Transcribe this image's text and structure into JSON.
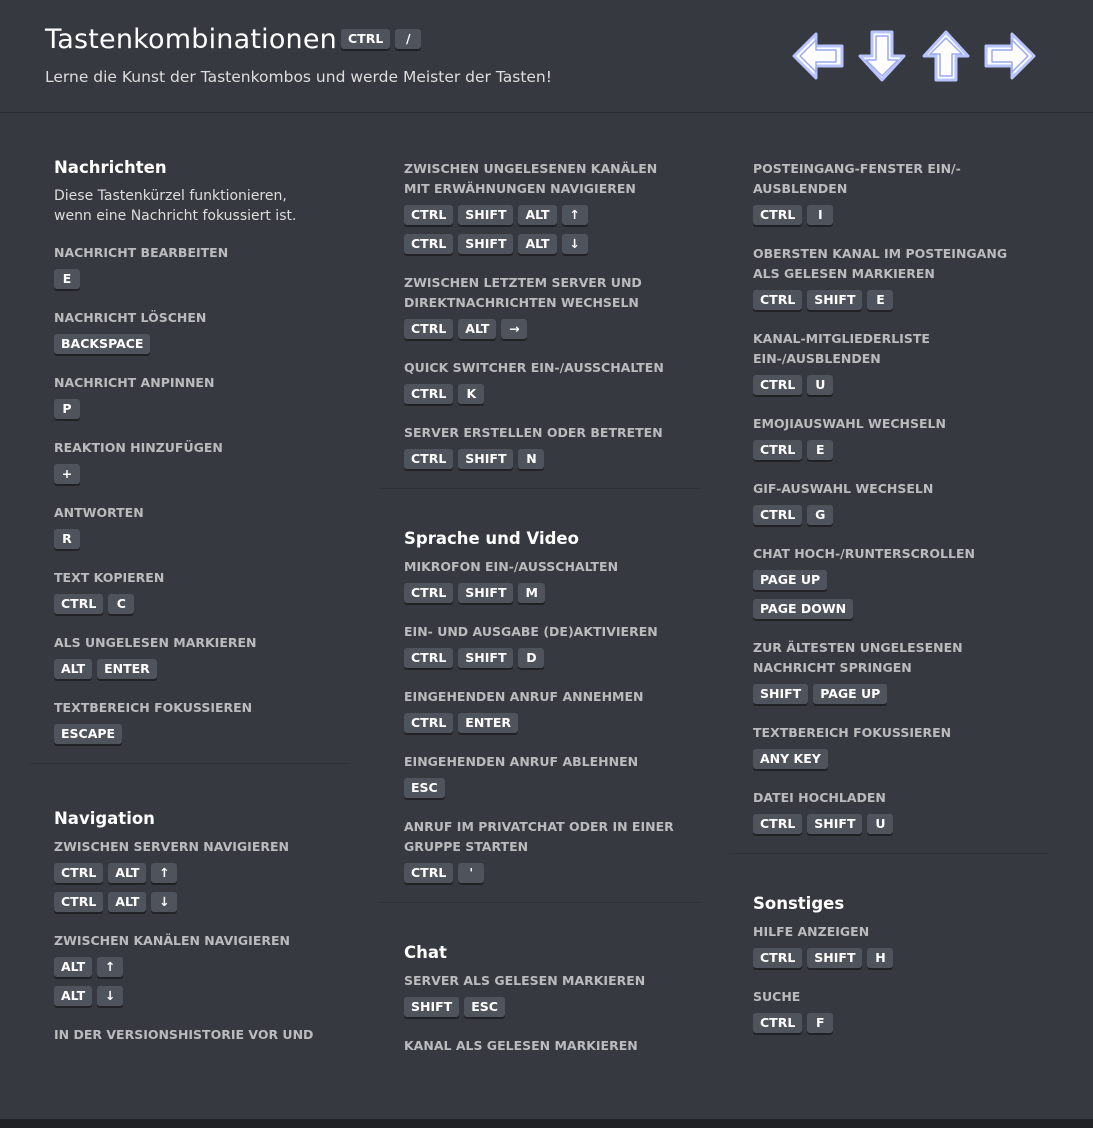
{
  "header": {
    "title": "Tastenkombinationen",
    "title_keys": [
      "CTRL",
      "/"
    ],
    "subtitle": "Lerne die Kunst der Tastenkombos und werde Meister der Tasten!",
    "arrow_icons": [
      "arrow-left-icon",
      "arrow-down-icon",
      "arrow-up-icon",
      "arrow-right-icon"
    ]
  },
  "columns": [
    {
      "sections": [
        {
          "title": "Nachrichten",
          "description": "Diese Tastenkürzel funktionieren, wenn eine Nachricht fokussiert ist.",
          "items": [
            {
              "label": "Nachricht bearbeiten",
              "combos": [
                [
                  "E"
                ]
              ]
            },
            {
              "label": "Nachricht löschen",
              "combos": [
                [
                  "BACKSPACE"
                ]
              ]
            },
            {
              "label": "Nachricht anpinnen",
              "combos": [
                [
                  "P"
                ]
              ]
            },
            {
              "label": "Reaktion hinzufügen",
              "combos": [
                [
                  "+"
                ]
              ]
            },
            {
              "label": "Antworten",
              "combos": [
                [
                  "R"
                ]
              ]
            },
            {
              "label": "Text kopieren",
              "combos": [
                [
                  "CTRL",
                  "C"
                ]
              ]
            },
            {
              "label": "Als ungelesen markieren",
              "combos": [
                [
                  "ALT",
                  "ENTER"
                ]
              ]
            },
            {
              "label": "Textbereich fokussieren",
              "combos": [
                [
                  "ESCAPE"
                ]
              ]
            }
          ]
        },
        {
          "title": "Navigation",
          "items": [
            {
              "label": "Zwischen Servern navigieren",
              "combos": [
                [
                  "CTRL",
                  "ALT",
                  "↑"
                ],
                [
                  "CTRL",
                  "ALT",
                  "↓"
                ]
              ]
            },
            {
              "label": "Zwischen Kanälen navigieren",
              "combos": [
                [
                  "ALT",
                  "↑"
                ],
                [
                  "ALT",
                  "↓"
                ]
              ]
            },
            {
              "label": "In der Versionshistorie vor und",
              "combos": []
            }
          ]
        }
      ]
    },
    {
      "sections": [
        {
          "title": "",
          "items": [
            {
              "label": "Zwischen ungelesenen Kanälen mit Erwähnungen navigieren",
              "combos": [
                [
                  "CTRL",
                  "SHIFT",
                  "ALT",
                  "↑"
                ],
                [
                  "CTRL",
                  "SHIFT",
                  "ALT",
                  "↓"
                ]
              ]
            },
            {
              "label": "Zwischen letztem Server und Direktnachrichten wechseln",
              "combos": [
                [
                  "CTRL",
                  "ALT",
                  "→"
                ]
              ]
            },
            {
              "label": "Quick Switcher ein-/ausschalten",
              "combos": [
                [
                  "CTRL",
                  "K"
                ]
              ]
            },
            {
              "label": "Server erstellen oder betreten",
              "combos": [
                [
                  "CTRL",
                  "SHIFT",
                  "N"
                ]
              ]
            }
          ]
        },
        {
          "title": "Sprache und Video",
          "items": [
            {
              "label": "Mikrofon ein-/ausschalten",
              "combos": [
                [
                  "CTRL",
                  "SHIFT",
                  "M"
                ]
              ]
            },
            {
              "label": "Ein- und Ausgabe (de)aktivieren",
              "combos": [
                [
                  "CTRL",
                  "SHIFT",
                  "D"
                ]
              ]
            },
            {
              "label": "Eingehenden Anruf annehmen",
              "combos": [
                [
                  "CTRL",
                  "ENTER"
                ]
              ]
            },
            {
              "label": "Eingehenden Anruf ablehnen",
              "combos": [
                [
                  "ESC"
                ]
              ]
            },
            {
              "label": "Anruf im Privatchat oder in einer Gruppe starten",
              "combos": [
                [
                  "CTRL",
                  "'"
                ]
              ]
            }
          ]
        },
        {
          "title": "Chat",
          "items": [
            {
              "label": "Server als gelesen markieren",
              "combos": [
                [
                  "SHIFT",
                  "ESC"
                ]
              ]
            },
            {
              "label": "Kanal als gelesen markieren",
              "combos": []
            }
          ]
        }
      ]
    },
    {
      "sections": [
        {
          "title": "",
          "items": [
            {
              "label": "Posteingang-Fenster ein/-ausblenden",
              "combos": [
                [
                  "CTRL",
                  "I"
                ]
              ]
            },
            {
              "label": "Obersten Kanal im Posteingang als gelesen markieren",
              "combos": [
                [
                  "CTRL",
                  "SHIFT",
                  "E"
                ]
              ]
            },
            {
              "label": "Kanal-Mitgliederliste ein-/ausblenden",
              "combos": [
                [
                  "CTRL",
                  "U"
                ]
              ]
            },
            {
              "label": "Emojiauswahl wechseln",
              "combos": [
                [
                  "CTRL",
                  "E"
                ]
              ]
            },
            {
              "label": "GIF-Auswahl wechseln",
              "combos": [
                [
                  "CTRL",
                  "G"
                ]
              ]
            },
            {
              "label": "Chat hoch-/runterscrollen",
              "combos": [
                [
                  "PAGE UP"
                ],
                [
                  "PAGE DOWN"
                ]
              ]
            },
            {
              "label": "Zur ältesten ungelesenen Nachricht springen",
              "combos": [
                [
                  "SHIFT",
                  "PAGE UP"
                ]
              ]
            },
            {
              "label": "Textbereich fokussieren",
              "combos": [
                [
                  "ANY KEY"
                ]
              ]
            },
            {
              "label": "Datei hochladen",
              "combos": [
                [
                  "CTRL",
                  "SHIFT",
                  "U"
                ]
              ]
            }
          ]
        },
        {
          "title": "Sonstiges",
          "items": [
            {
              "label": "Hilfe anzeigen",
              "combos": [
                [
                  "CTRL",
                  "SHIFT",
                  "H"
                ]
              ]
            },
            {
              "label": "Suche",
              "combos": [
                [
                  "CTRL",
                  "F"
                ]
              ]
            }
          ]
        }
      ]
    }
  ]
}
